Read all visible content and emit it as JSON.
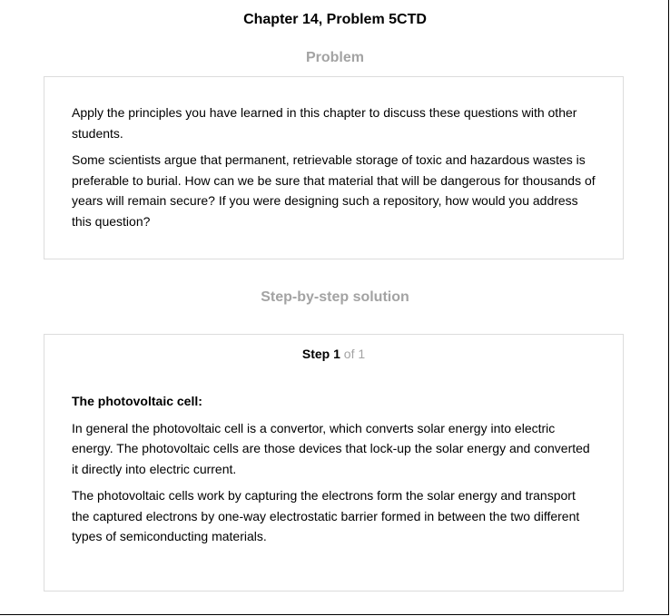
{
  "header": {
    "title": "Chapter 14, Problem 5CTD"
  },
  "problem": {
    "heading": "Problem",
    "paragraphs": [
      "Apply the principles you have learned in this chapter to discuss these questions with other students.",
      "Some scientists argue that permanent, retrievable storage of toxic and hazardous wastes is preferable to burial. How can we be sure that material that will be dangerous for thousands of years will remain secure? If you were designing such a repository, how would you address this question?"
    ]
  },
  "solution": {
    "heading": "Step-by-step solution",
    "step": {
      "word": "Step",
      "number": "1",
      "of_text": "of 1"
    },
    "subheading": "The photovoltaic cell:",
    "paragraphs": [
      "In general the photovoltaic cell is a convertor, which converts solar energy into electric energy. The photovoltaic cells are those devices that lock-up the solar energy and converted it directly into electric current.",
      "The photovoltaic cells work by capturing the electrons form the solar energy and transport the captured electrons by one-way electrostatic barrier formed in between the two different types of semiconducting materials."
    ]
  }
}
